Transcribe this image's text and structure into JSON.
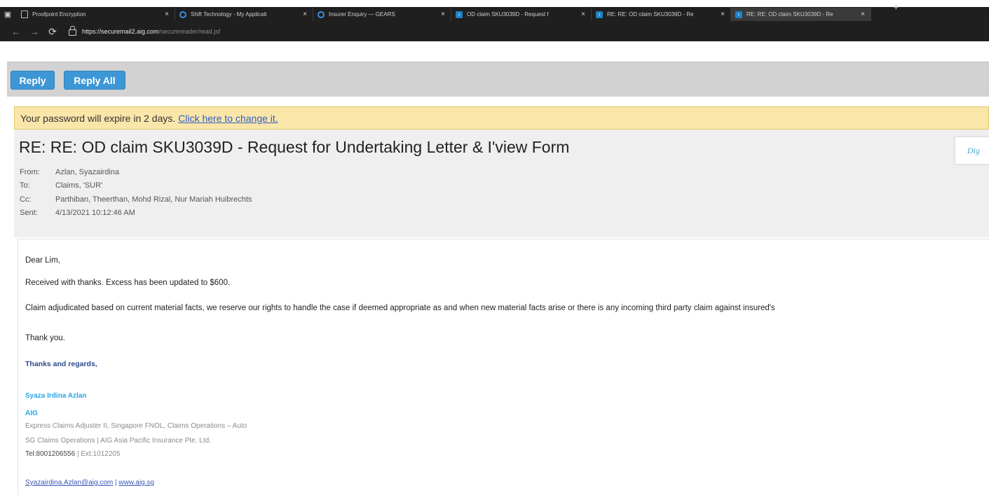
{
  "browser": {
    "tabs": [
      {
        "title": "Proofpoint Encryption",
        "icon": "page-icon"
      },
      {
        "title": "Shift Technology - My Applicati",
        "icon": "ring-icon"
      },
      {
        "title": "Insurer Enquiry — GEARS",
        "icon": "ring-icon"
      },
      {
        "title": "OD claim SKU3039D - Request f",
        "icon": "arrow-icon"
      },
      {
        "title": "RE: RE: OD claim SKU3039D - Re",
        "icon": "arrow-icon"
      },
      {
        "title": "RE: RE: OD claim SKU3039D - Re",
        "icon": "arrow-icon"
      }
    ],
    "tab_close": "×",
    "new_tab": "+",
    "url_host": "https://securemail2.aig.com",
    "url_path": "/securereader/read.jsf"
  },
  "toolbar": {
    "reply_label": "Reply",
    "reply_all_label": "Reply All"
  },
  "notice": {
    "text": "Your password will expire in 2 days.",
    "link": "Click here to change it."
  },
  "message": {
    "subject": "RE: RE: OD claim SKU3039D - Request for Undertaking Letter & I'view Form",
    "side_tab": "Dig",
    "from_label": "From:",
    "from": "Azlan, Syazairdina",
    "to_label": "To:",
    "to": "Claims, 'SUR'",
    "cc_label": "Cc:",
    "cc": "Parthiban, Theerthan, Mohd Rizal, Nur Mariah Huibrechts",
    "sent_label": "Sent:",
    "sent": "4/13/2021 10:12:46 AM"
  },
  "body": {
    "greeting": "Dear Lim,",
    "line1": "Received with thanks. Excess has been updated to $600.",
    "line2": "Claim adjudicated based on current material facts, we reserve our rights to handle the case if deemed appropriate as and when new material facts arise or there is any incoming third party claim against insured's",
    "line3": "Thank you.",
    "closing": "Thanks and regards,"
  },
  "signature": {
    "name": "Syaza Irdina Azlan",
    "company": "AIG",
    "title": "Express Claims Adjuster II, Singapore FNOL, Claims Operations – Auto",
    "dept": "SG Claims Operations  | AIG Asia Pacific Insurance Pte. Ltd.",
    "tel": "Tel:8001206556",
    "ext": " | Ext:1012205",
    "email": "Syazairdina.Azlan@aig.com",
    "sep": " | ",
    "web": "www.aig.sg"
  },
  "colors": {
    "reply_button": "#3d97d6",
    "notice_bg": "#fae6a9",
    "link": "#2f5fc4",
    "signature_name": "#29a6e6"
  }
}
